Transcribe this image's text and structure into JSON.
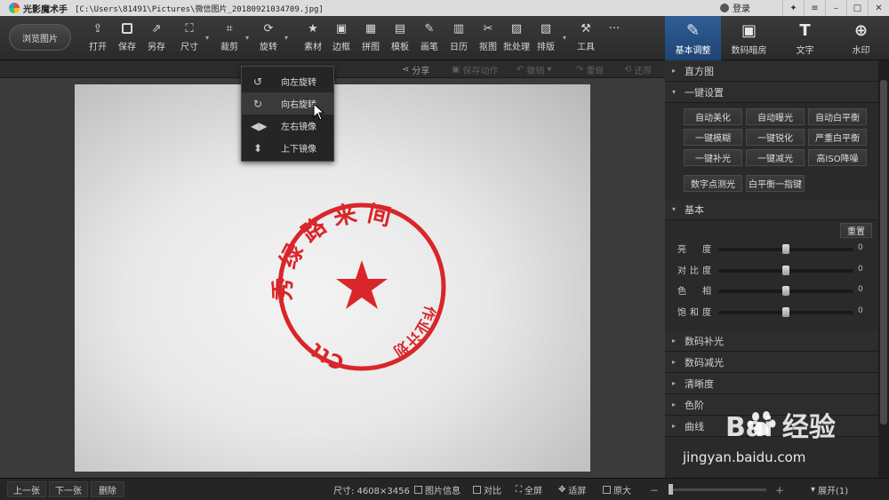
{
  "window": {
    "app_name": "光影魔术手",
    "file_path": "[C:\\Users\\81491\\Pictures\\微信图片_20180921034709.jpg]",
    "login_label": "登录"
  },
  "toolbar": {
    "browse_label": "浏览图片",
    "tools": [
      {
        "label": "打开",
        "icon": "open-icon"
      },
      {
        "label": "保存",
        "icon": "save-icon"
      },
      {
        "label": "另存",
        "icon": "save-as-icon"
      },
      {
        "label": "尺寸",
        "icon": "resize-icon"
      },
      {
        "label": "裁剪",
        "icon": "crop-icon"
      },
      {
        "label": "旋转",
        "icon": "rotate-icon"
      },
      {
        "label": "素材",
        "icon": "material-icon"
      },
      {
        "label": "边框",
        "icon": "border-icon"
      },
      {
        "label": "拼图",
        "icon": "collage-icon"
      },
      {
        "label": "模板",
        "icon": "template-icon"
      },
      {
        "label": "画笔",
        "icon": "brush-icon"
      },
      {
        "label": "日历",
        "icon": "calendar-icon"
      },
      {
        "label": "抠图",
        "icon": "cutout-icon"
      },
      {
        "label": "批处理",
        "icon": "batch-icon"
      },
      {
        "label": "排版",
        "icon": "layout-icon"
      },
      {
        "label": "工具",
        "icon": "wrench-icon"
      }
    ],
    "more_label": "···"
  },
  "right_tabs": [
    {
      "label": "基本调整",
      "icon": "adjust-icon",
      "active": true
    },
    {
      "label": "数码暗房",
      "icon": "darkroom-icon",
      "active": false
    },
    {
      "label": "文字",
      "icon": "text-icon",
      "active": false
    },
    {
      "label": "水印",
      "icon": "watermark-icon",
      "active": false
    }
  ],
  "subbar": {
    "share": "分享",
    "save_action": "保存动作",
    "undo": "撤销",
    "redo": "重做",
    "restore": "还原"
  },
  "rotate_menu": {
    "items": [
      "向左旋转",
      "向右旋转",
      "左右镜像",
      "上下镜像"
    ],
    "hovered_index": 1
  },
  "stamp": {
    "color": "#d9262a",
    "outer_text": "秀 绿 路 来 间",
    "inner_text": "作业计划审批章",
    "bottom_text": "Ctt"
  },
  "panel": {
    "histogram": "直方图",
    "one_click": "一键设置",
    "one_click_buttons": [
      "自动美化",
      "自动曝光",
      "自动白平衡",
      "一键模糊",
      "一键锐化",
      "严重白平衡",
      "一键补光",
      "一键减光",
      "高ISO降噪"
    ],
    "extra_buttons": [
      "数字点测光",
      "白平衡一指键"
    ],
    "basic": "基本",
    "reset": "重置",
    "sliders": [
      {
        "label": "亮　度",
        "value": 0
      },
      {
        "label": "对比度",
        "value": 0
      },
      {
        "label": "色　相",
        "value": 0
      },
      {
        "label": "饱和度",
        "value": 0
      }
    ],
    "sections": [
      "数码补光",
      "数码减光",
      "清晰度",
      "色阶",
      "曲线"
    ]
  },
  "watermark": {
    "brand": "Bai  经验",
    "url": "jingyan.baidu.com"
  },
  "bottombar": {
    "prev": "上一张",
    "next": "下一张",
    "delete": "删除",
    "size": "尺寸: 4608×3456",
    "info": "图片信息",
    "compare": "对比",
    "fullscreen": "全屏",
    "fit": "适屏",
    "original": "原大",
    "zoom_out": "－",
    "zoom_in": "＋",
    "expand": "展开(1)"
  }
}
